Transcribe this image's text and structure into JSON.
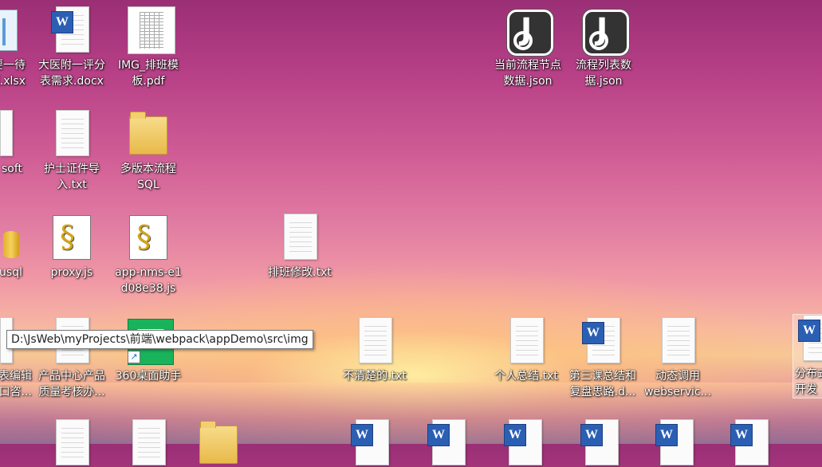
{
  "desktop": {
    "icons": [
      {
        "label": "要一待\n项.xlsx"
      },
      {
        "label": "大医附一评分\n表需求.docx"
      },
      {
        "label": "IMG_排班模\n板.pdf"
      },
      {
        "label": "当前流程节点\n数据.json"
      },
      {
        "label": "流程列表数\n据.json"
      },
      {
        "label": "soft"
      },
      {
        "label": "护士证件导\n入.txt"
      },
      {
        "label": "多版本流程\nSQL"
      },
      {
        "label": "usql"
      },
      {
        "label": "proxy.js"
      },
      {
        "label": "app-nms-e1\nd08e38.js"
      },
      {
        "label": "排班修改.txt"
      },
      {
        "label": "表编辑\n口咨..."
      },
      {
        "label": "产品中心产品\n质量考核办..."
      },
      {
        "label": "360桌面助手"
      },
      {
        "label": "不清楚的.txt"
      },
      {
        "label": "个人总结.txt"
      },
      {
        "label": "第三课总结和\n复盘思路.d..."
      },
      {
        "label": "动态调用\nwebservic..."
      },
      {
        "label": "分布式\n开发"
      }
    ],
    "tooltip": "D:\\JsWeb\\myProjects\\前端\\webpack\\appDemo\\src\\img",
    "icon_types": [
      "excel-icon",
      "word-icon",
      "pdf-thumbnail-icon",
      "json-icon",
      "json-icon",
      "document-icon",
      "text-file-icon",
      "folder-icon",
      "database-icon",
      "script-icon",
      "script-icon",
      "text-file-icon",
      "document-icon",
      "document-icon",
      "app-360-icon",
      "text-file-icon",
      "text-file-icon",
      "word-icon",
      "text-file-icon",
      "word-icon"
    ]
  }
}
